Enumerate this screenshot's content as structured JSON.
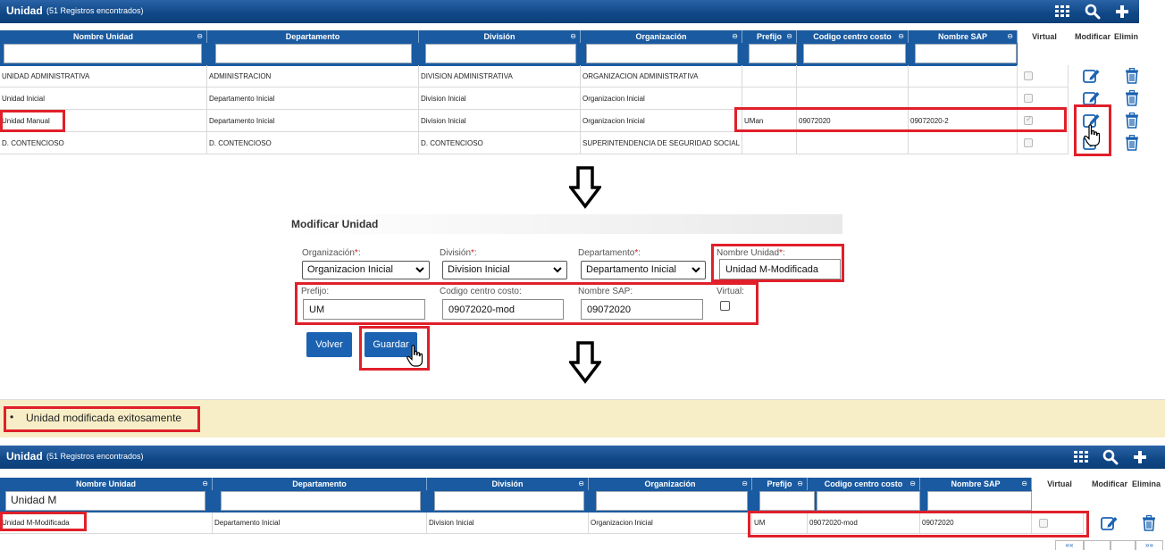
{
  "grid_top": {
    "title": "Unidad",
    "count": "(51 Registros encontrados)",
    "headers": {
      "nombre": "Nombre Unidad",
      "departamento": "Departamento",
      "division": "División",
      "organizacion": "Organización",
      "prefijo": "Prefijo",
      "codigo": "Codigo centro costo",
      "sap": "Nombre SAP",
      "virtual": "Virtual",
      "modificar": "Modificar",
      "eliminar": "Elimin"
    },
    "sort_glyph": "⊖",
    "rows": [
      {
        "nombre": "UNIDAD ADMINISTRATIVA",
        "departamento": "ADMINISTRACION",
        "division": "DIVISION ADMINISTRATIVA",
        "organizacion": "ORGANIZACION ADMINISTRATIVA",
        "prefijo": "",
        "codigo": "",
        "sap": "",
        "virtual": false
      },
      {
        "nombre": "Unidad Inicial",
        "departamento": "Departamento Inicial",
        "division": "Division Inicial",
        "organizacion": "Organizacion Inicial",
        "prefijo": "",
        "codigo": "",
        "sap": "",
        "virtual": false
      },
      {
        "nombre": "Unidad Manual",
        "departamento": "Departamento Inicial",
        "division": "Division Inicial",
        "organizacion": "Organizacion Inicial",
        "prefijo": "UMan",
        "codigo": "09072020",
        "sap": "09072020-2",
        "virtual": true
      },
      {
        "nombre": "D. CONTENCIOSO",
        "departamento": "D. CONTENCIOSO",
        "division": "D. CONTENCIOSO",
        "organizacion": "SUPERINTENDENCIA DE SEGURIDAD SOCIAL",
        "prefijo": "",
        "codigo": "",
        "sap": "",
        "virtual": false
      }
    ]
  },
  "form": {
    "title": "Modificar Unidad",
    "org_label": "Organización",
    "org_value": "Organizacion Inicial",
    "div_label": "División",
    "div_value": "Division Inicial",
    "dep_label": "Departamento",
    "dep_value": "Departamento Inicial",
    "nombre_label": "Nombre Unidad",
    "nombre_value": "Unidad M-Modificada",
    "prefijo_label": "Prefijo:",
    "prefijo_value": "UM",
    "codigo_label": "Codigo centro costo:",
    "codigo_value": "09072020-mod",
    "sap_label": "Nombre SAP:",
    "sap_value": "09072020",
    "virtual_label": "Virtual:",
    "virtual_checked": false,
    "req_marker": "*",
    "label_suffix": ":",
    "volver": "Volver",
    "guardar": "Guardar"
  },
  "message": {
    "bullet": "•",
    "text": "Unidad modificada exitosamente"
  },
  "grid_bottom": {
    "title": "Unidad",
    "count": "(51 Registros encontrados)",
    "headers": {
      "nombre": "Nombre Unidad",
      "departamento": "Departamento",
      "division": "División",
      "organizacion": "Organización",
      "prefijo": "Prefijo",
      "codigo": "Codigo centro costo",
      "sap": "Nombre SAP",
      "virtual": "Virtual",
      "modificar": "Modificar",
      "eliminar": "Elimina"
    },
    "filter_nombre": "Unidad M",
    "rows": [
      {
        "nombre": "Unidad M-Modificada",
        "departamento": "Departamento Inicial",
        "division": "Division Inicial",
        "organizacion": "Organizacion Inicial",
        "prefijo": "UM",
        "codigo": "09072020-mod",
        "sap": "09072020",
        "virtual": false
      }
    ],
    "pager_first": "««",
    "pager_last": "»»"
  },
  "icons": {
    "grid": "grid-icon",
    "search": "search-icon",
    "add": "plus-icon",
    "edit": "edit-icon",
    "delete": "trash-icon",
    "arrow": "down-arrow-icon",
    "cursor": "hand-cursor-icon"
  },
  "colors": {
    "header_blue": "#0f4786",
    "button_blue": "#1b63b2",
    "highlight_red": "#e0202a",
    "message_bg": "#f7eec7"
  }
}
